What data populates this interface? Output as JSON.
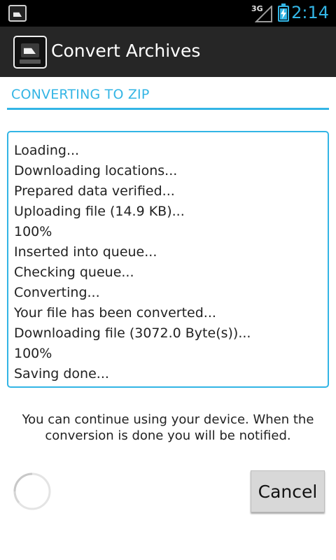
{
  "status_bar": {
    "network_type": "3G",
    "time": "2:14",
    "accent_color": "#33b5e5"
  },
  "action_bar": {
    "title": "Convert Archives",
    "icon": "app-archive-icon"
  },
  "section": {
    "header": "CONVERTING TO ZIP"
  },
  "log": {
    "lines": [
      "Loading...",
      "Downloading locations...",
      "Prepared data verified...",
      "Uploading file (14.9 KB)...",
      "100%",
      "Inserted into queue...",
      "Checking queue...",
      "Converting...",
      "Your file has been converted...",
      "Downloading file (3072.0 Byte(s))...",
      "100%",
      "Saving done..."
    ]
  },
  "info": {
    "message": "You can continue using your device. When the conversion is done you will be notified."
  },
  "actions": {
    "cancel_label": "Cancel"
  }
}
